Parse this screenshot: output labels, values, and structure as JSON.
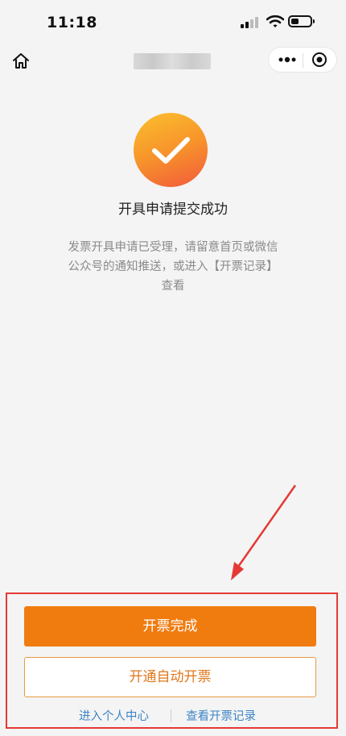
{
  "status_bar": {
    "time": "11:18",
    "battery_level": 0.25
  },
  "nav": {
    "home_icon": "home-icon",
    "more_icon": "more-dots-icon",
    "close_icon": "target-circle-icon"
  },
  "result": {
    "icon": "checkmark-icon",
    "title": "开具申请提交成功",
    "description_line1": "发票开具申请已受理，请留意首页或微信",
    "description_line2": "公众号的通知推送，或进入【开票记录】",
    "description_line3": "查看"
  },
  "actions": {
    "primary_label": "开票完成",
    "secondary_label": "开通自动开票",
    "link_personal_center": "进入个人中心",
    "link_invoice_records": "查看开票记录"
  },
  "colors": {
    "accent": "#f07c10",
    "link": "#3d84c6",
    "annotation": "#e53935"
  }
}
